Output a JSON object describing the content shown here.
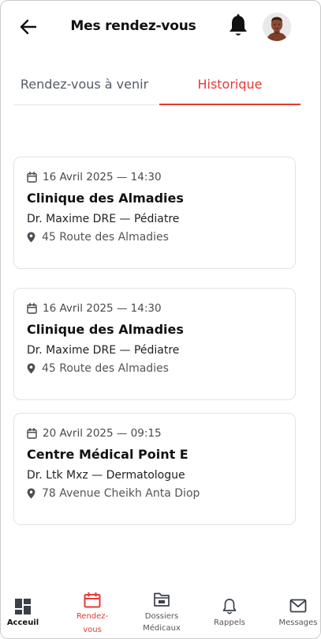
{
  "header": {
    "title": "Mes rendez-vous"
  },
  "tabs": [
    {
      "label": "Rendez-vous à venir",
      "active": false
    },
    {
      "label": "Historique",
      "active": true
    }
  ],
  "appointments": [
    {
      "date": "16 Avril 2025 — 14:30",
      "clinic": "Clinique des Almadies",
      "doctor": "Dr. Maxime DRE — Pédiatre",
      "address": "45 Route des Almadies"
    },
    {
      "date": "16 Avril 2025 — 14:30",
      "clinic": "Clinique des Almadies",
      "doctor": "Dr. Maxime DRE — Pédiatre",
      "address": "45 Route des Almadies"
    },
    {
      "date": "20 Avril 2025 — 09:15",
      "clinic": "Centre Médical Point E",
      "doctor": "Dr. Ltk Mxz — Dermatologue",
      "address": "78 Avenue Cheikh Anta Diop"
    }
  ],
  "bottom_nav": {
    "accueil": "Acceuil",
    "rdv_line1": "Rendez-",
    "rdv_line2": "vous",
    "dossiers_line1": "Dossiers",
    "dossiers_line2": "Médicaux",
    "rappels": "Rappels",
    "messages": "Messages"
  },
  "icons": {
    "back": "arrow-left-icon",
    "bell": "bell-icon",
    "calendar": "calendar-icon",
    "pin": "map-pin-icon",
    "home": "grid-home-icon",
    "folder": "medical-folder-icon",
    "mail": "envelope-icon"
  },
  "colors": {
    "accent": "#e53935",
    "text": "#111111",
    "muted": "#555b66",
    "border": "#e2e2e2"
  }
}
